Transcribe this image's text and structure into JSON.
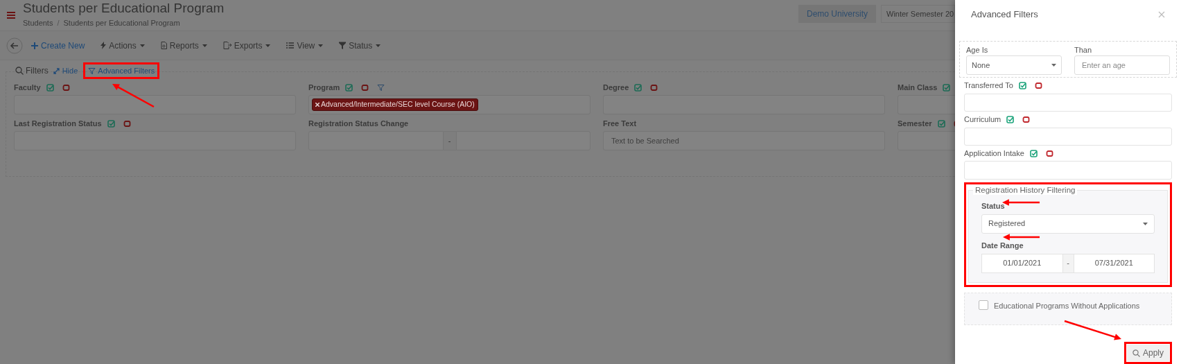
{
  "header": {
    "title": "Students per Educational Program",
    "breadcrumb": [
      "Students",
      "Students per Educational Program"
    ],
    "breadcrumb_separator": "/",
    "university": "Demo University",
    "semester": "Winter Semester 20"
  },
  "toolbar": [
    {
      "label": "Create New",
      "dropdown": false
    },
    {
      "label": "Actions",
      "dropdown": true
    },
    {
      "label": "Reports",
      "dropdown": true
    },
    {
      "label": "Exports",
      "dropdown": true
    },
    {
      "label": "View",
      "dropdown": true
    },
    {
      "label": "Status",
      "dropdown": true
    }
  ],
  "filters": {
    "title": "Filters",
    "hide": "Hide",
    "advanced": "Advanced Filters",
    "fields": [
      {
        "label": "Faculty",
        "kind": "select",
        "toggles": true
      },
      {
        "label": "Program",
        "kind": "select",
        "toggles": true,
        "funnel": true,
        "chips": [
          "Advanced/Intermediate/SEC level Course (AIO)"
        ]
      },
      {
        "label": "Degree",
        "kind": "select",
        "toggles": true
      },
      {
        "label": "Main Class",
        "kind": "select",
        "toggles": true
      },
      {
        "label": "Last Registration Status",
        "kind": "select",
        "toggles": true
      },
      {
        "label": "Registration Status Change",
        "kind": "range",
        "separator": "-"
      },
      {
        "label": "Free Text",
        "kind": "text",
        "placeholder": "Text to be Searched"
      },
      {
        "label": "Semester",
        "kind": "select",
        "toggles": true
      }
    ]
  },
  "panel": {
    "title": "Advanced Filters",
    "age": {
      "label": "Age Is",
      "value": "None",
      "than_label": "Than",
      "placeholder": "Enter an age"
    },
    "fields": [
      {
        "label": "Transferred To",
        "toggles": true
      },
      {
        "label": "Curriculum",
        "toggles": true
      },
      {
        "label": "Application Intake",
        "toggles": true
      }
    ],
    "history": {
      "legend": "Registration History Filtering",
      "status_label": "Status",
      "status_value": "Registered",
      "date_label": "Date Range",
      "from": "01/01/2021",
      "separator": "-",
      "to": "07/31/2021"
    },
    "without_applications": {
      "label": "Educational Programs Without Applications",
      "checked": false
    },
    "apply": "Apply"
  }
}
